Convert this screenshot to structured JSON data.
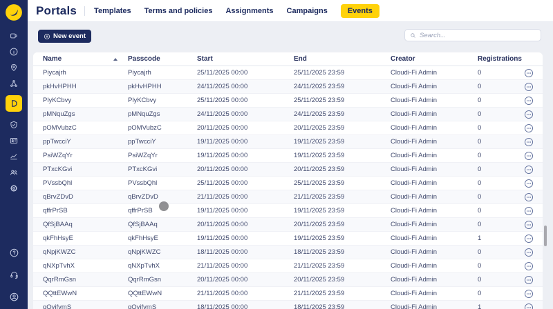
{
  "app": {
    "title": "Portals"
  },
  "colors": {
    "accent_yellow": "#FFD20A",
    "navy": "#1D2B5F",
    "content_bg": "#EDEFF4"
  },
  "header": {
    "tabs": [
      {
        "label": "Templates",
        "active": false
      },
      {
        "label": "Terms and policies",
        "active": false
      },
      {
        "label": "Assignments",
        "active": false
      },
      {
        "label": "Campaigns",
        "active": false
      },
      {
        "label": "Events",
        "active": true
      }
    ]
  },
  "toolbar": {
    "new_event_label": "New event",
    "search_placeholder": "Search..."
  },
  "sidebar": {
    "icons": [
      "devices-icon",
      "info-icon",
      "locations-icon",
      "network-icon",
      "portals-icon",
      "security-icon",
      "id-card-icon",
      "analytics-icon",
      "users-icon",
      "settings-icon"
    ],
    "active_icon": "portals-icon",
    "bottom_icons": [
      "help-icon",
      "support-icon",
      "account-icon"
    ]
  },
  "table": {
    "columns": [
      "Name",
      "Passcode",
      "Start",
      "End",
      "Creator",
      "Registrations"
    ],
    "sorted_by": "Name",
    "sort_direction": "asc",
    "rows": [
      {
        "name": "Piycajrh",
        "passcode": "Piycajrh",
        "start": "25/11/2025 00:00",
        "end": "25/11/2025 23:59",
        "creator": "Cloudi-Fi Admin",
        "registrations": "0"
      },
      {
        "name": "pkHvHPHH",
        "passcode": "pkHvHPHH",
        "start": "24/11/2025 00:00",
        "end": "24/11/2025 23:59",
        "creator": "Cloudi-Fi Admin",
        "registrations": "0"
      },
      {
        "name": "PlyKCbvy",
        "passcode": "PlyKCbvy",
        "start": "25/11/2025 00:00",
        "end": "25/11/2025 23:59",
        "creator": "Cloudi-Fi Admin",
        "registrations": "0"
      },
      {
        "name": "pMNquZgs",
        "passcode": "pMNquZgs",
        "start": "24/11/2025 00:00",
        "end": "24/11/2025 23:59",
        "creator": "Cloudi-Fi Admin",
        "registrations": "0"
      },
      {
        "name": "pOMVubzC",
        "passcode": "pOMVubzC",
        "start": "20/11/2025 00:00",
        "end": "20/11/2025 23:59",
        "creator": "Cloudi-Fi Admin",
        "registrations": "0"
      },
      {
        "name": "ppTwcciY",
        "passcode": "ppTwcciY",
        "start": "19/11/2025 00:00",
        "end": "19/11/2025 23:59",
        "creator": "Cloudi-Fi Admin",
        "registrations": "0"
      },
      {
        "name": "PsiWZqYr",
        "passcode": "PsiWZqYr",
        "start": "19/11/2025 00:00",
        "end": "19/11/2025 23:59",
        "creator": "Cloudi-Fi Admin",
        "registrations": "0"
      },
      {
        "name": "PTxcKGvi",
        "passcode": "PTxcKGvi",
        "start": "20/11/2025 00:00",
        "end": "20/11/2025 23:59",
        "creator": "Cloudi-Fi Admin",
        "registrations": "0"
      },
      {
        "name": "PVssbQhl",
        "passcode": "PVssbQhl",
        "start": "25/11/2025 00:00",
        "end": "25/11/2025 23:59",
        "creator": "Cloudi-Fi Admin",
        "registrations": "0"
      },
      {
        "name": "qBrvZDvD",
        "passcode": "qBrvZDvD",
        "start": "21/11/2025 00:00",
        "end": "21/11/2025 23:59",
        "creator": "Cloudi-Fi Admin",
        "registrations": "0"
      },
      {
        "name": "qffrPrSB",
        "passcode": "qffrPrSB",
        "start": "19/11/2025 00:00",
        "end": "19/11/2025 23:59",
        "creator": "Cloudi-Fi Admin",
        "registrations": "0"
      },
      {
        "name": "QfSjBAAq",
        "passcode": "QfSjBAAq",
        "start": "20/11/2025 00:00",
        "end": "20/11/2025 23:59",
        "creator": "Cloudi-Fi Admin",
        "registrations": "0"
      },
      {
        "name": "qkFhHsyE",
        "passcode": "qkFhHsyE",
        "start": "19/11/2025 00:00",
        "end": "19/11/2025 23:59",
        "creator": "Cloudi-Fi Admin",
        "registrations": "1"
      },
      {
        "name": "qNpjKWZC",
        "passcode": "qNpjKWZC",
        "start": "18/11/2025 00:00",
        "end": "18/11/2025 23:59",
        "creator": "Cloudi-Fi Admin",
        "registrations": "0"
      },
      {
        "name": "qNXpTvhX",
        "passcode": "qNXpTvhX",
        "start": "21/11/2025 00:00",
        "end": "21/11/2025 23:59",
        "creator": "Cloudi-Fi Admin",
        "registrations": "0"
      },
      {
        "name": "QqrRmGsn",
        "passcode": "QqrRmGsn",
        "start": "20/11/2025 00:00",
        "end": "20/11/2025 23:59",
        "creator": "Cloudi-Fi Admin",
        "registrations": "0"
      },
      {
        "name": "QQttEWwN",
        "passcode": "QQttEWwN",
        "start": "21/11/2025 00:00",
        "end": "21/11/2025 23:59",
        "creator": "Cloudi-Fi Admin",
        "registrations": "0"
      },
      {
        "name": "qQvjfvmS",
        "passcode": "qQvjfvmS",
        "start": "18/11/2025 00:00",
        "end": "18/11/2025 23:59",
        "creator": "Cloudi-Fi Admin",
        "registrations": "1"
      }
    ]
  }
}
